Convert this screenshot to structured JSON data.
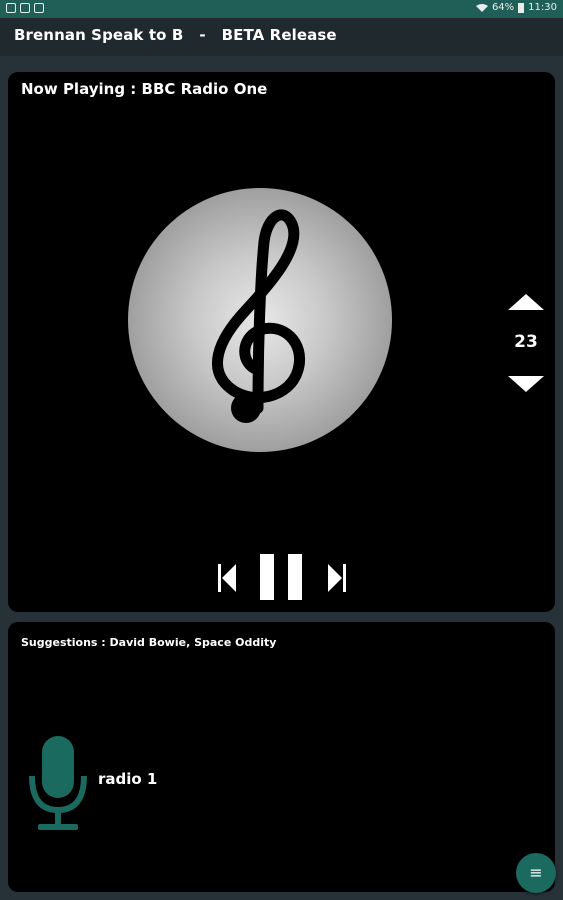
{
  "status_bar": {
    "battery": "64%",
    "time": "11:30"
  },
  "app_bar": {
    "title": "Brennan Speak to B   -   BETA Release"
  },
  "player": {
    "now_playing": "Now Playing : BBC Radio One",
    "artwork_icon": "treble-clef-icon",
    "volume": "23",
    "controls": [
      "previous-icon",
      "pause-icon",
      "next-icon"
    ]
  },
  "suggestions": {
    "text": "Suggestions : David Bowie, Space Oddity",
    "query": "radio 1",
    "mic_icon": "microphone-icon"
  },
  "fab": {
    "icon": "menu-icon",
    "glyph": "≡"
  },
  "colors": {
    "status_bar": "#1f5f58",
    "background": "#263238",
    "card": "#000000",
    "accent": "#1b6a60"
  }
}
